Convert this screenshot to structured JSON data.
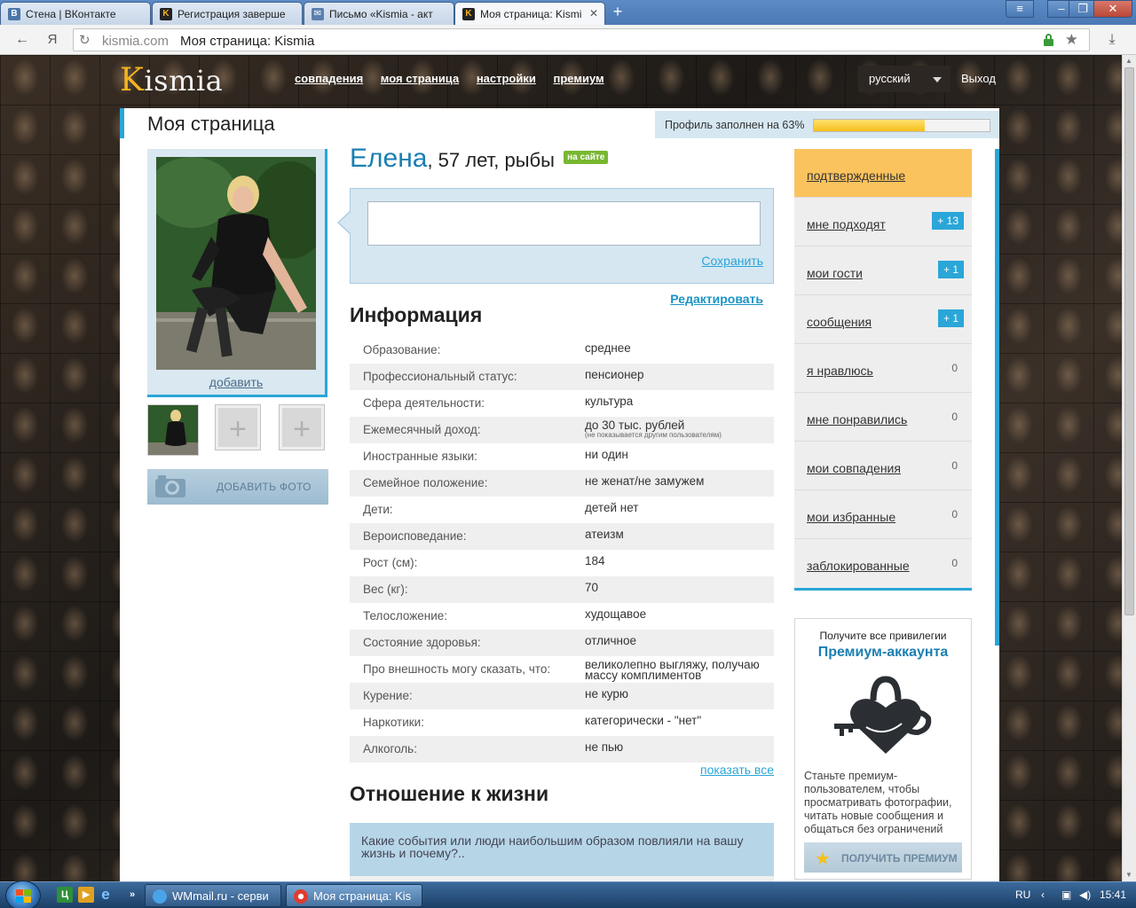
{
  "browser": {
    "tabs": [
      {
        "title": "Стена | ВКонтакте",
        "icon": "vk-icon",
        "color": "#4a76a8",
        "glyph": "В"
      },
      {
        "title": "Регистрация заверше",
        "icon": "kismia-icon",
        "color": "#222222",
        "glyph": "K"
      },
      {
        "title": "Письмо «Kismia - акт",
        "icon": "mail-icon",
        "color": "#5b7fae",
        "glyph": "✉"
      },
      {
        "title": "Моя страница: Kismi",
        "icon": "kismia-icon",
        "color": "#222222",
        "glyph": "K"
      }
    ],
    "nav_brand": "Я",
    "url_domain": "kismia.com",
    "url_title": "Моя страница: Kismia"
  },
  "site": {
    "logo_first": "K",
    "logo_rest": "ismia",
    "nav": [
      "совпадения",
      "моя страница",
      "настройки",
      "премиум"
    ],
    "language": "русский",
    "logout": "Выход"
  },
  "page": {
    "title": "Моя страница",
    "profile_progress_label": "Профиль заполнен на 63%",
    "profile_progress": 0.63
  },
  "photos": {
    "add_link": "добавить",
    "add_photo_button": "ДОБАВИТЬ ФОТО",
    "empty_slot_glyph": "+"
  },
  "profile": {
    "name": "Елена",
    "details": ", 57 лет, рыбы",
    "online_badge": "на сайте",
    "save_label": "Сохранить",
    "edit_label": "Редактировать",
    "info_heading": "Информация",
    "info": [
      {
        "key": "Образование:",
        "value": "среднее"
      },
      {
        "key": "Профессиональный статус:",
        "value": "пенсионер"
      },
      {
        "key": "Сфера деятельности:",
        "value": "культура"
      },
      {
        "key": "Ежемесячный доход:",
        "value": "до 30 тыс. рублей",
        "note": "(не показывается другим пользователям)"
      },
      {
        "key": "Иностранные языки:",
        "value": "ни один"
      },
      {
        "key": "Семейное положение:",
        "value": "не женат/не замужем"
      },
      {
        "key": "Дети:",
        "value": "детей нет"
      },
      {
        "key": "Вероисповедание:",
        "value": "атеизм"
      },
      {
        "key": "Рост (см):",
        "value": "184"
      },
      {
        "key": "Вес (кг):",
        "value": "70"
      },
      {
        "key": "Телосложение:",
        "value": "худощавое"
      },
      {
        "key": "Состояние здоровья:",
        "value": "отличное"
      },
      {
        "key": "Про внешность могу сказать, что:",
        "value": "великолепно выгляжу, получаю массу комплиментов"
      },
      {
        "key": "Курение:",
        "value": "не курю"
      },
      {
        "key": "Наркотики:",
        "value": "категорически - \"нет\""
      },
      {
        "key": "Алкоголь:",
        "value": "не пью"
      }
    ],
    "show_all": "показать все",
    "life_heading": "Отношение к жизни",
    "question": "Какие события или люди наибольшим образом повлияли на вашу жизнь и почему?.."
  },
  "sidebar": {
    "items": [
      {
        "label": "подтвержденные",
        "badge": "",
        "count": ""
      },
      {
        "label": "мне подходят",
        "badge": "+ 13",
        "count": ""
      },
      {
        "label": "мои гости",
        "badge": "+ 1",
        "count": ""
      },
      {
        "label": "сообщения",
        "badge": "+ 1",
        "count": ""
      },
      {
        "label": "я нравлюсь",
        "badge": "",
        "count": "0"
      },
      {
        "label": "мне понравились",
        "badge": "",
        "count": "0"
      },
      {
        "label": "мои совпадения",
        "badge": "",
        "count": "0"
      },
      {
        "label": "мои избранные",
        "badge": "",
        "count": "0"
      },
      {
        "label": "заблокированные",
        "badge": "",
        "count": "0"
      }
    ]
  },
  "premium": {
    "top": "Получите все привилегии",
    "title": "Премиум-аккаунта",
    "text": "Станьте премиум-пользователем, чтобы просматривать фотографии, читать новые сообщения и общаться без ограничений",
    "button": "ПОЛУЧИТЬ ПРЕМИУМ"
  },
  "taskbar": {
    "tasks": [
      {
        "label": "WMmail.ru - серви",
        "icon": "ie-icon"
      },
      {
        "label": "Моя страница: Kis",
        "icon": "yandex-browser-icon"
      }
    ],
    "tray_lang": "RU",
    "clock": "15:41"
  }
}
